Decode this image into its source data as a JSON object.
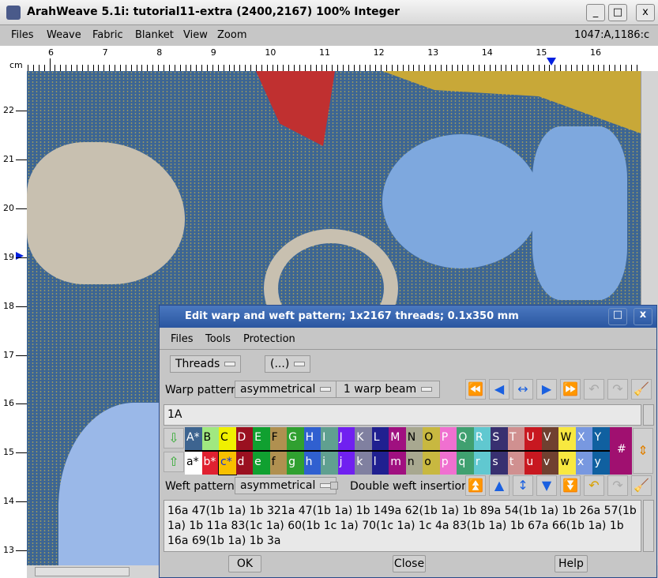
{
  "window": {
    "title": "ArahWeave 5.1i: tutorial11-extra (2400,2167) 100% Integer",
    "min": "_",
    "max": "□",
    "close": "x"
  },
  "menu": [
    "Files",
    "Weave",
    "Fabric",
    "Blanket",
    "View",
    "Zoom"
  ],
  "coords": "1047:A,1186:c",
  "ruler": {
    "unit": "cm",
    "top": [
      "6",
      "7",
      "8",
      "9",
      "10",
      "11",
      "12",
      "13",
      "14",
      "15",
      "16"
    ],
    "left": [
      "22",
      "21",
      "20",
      "19",
      "18",
      "17",
      "16",
      "15",
      "14",
      "13"
    ]
  },
  "dialog": {
    "title": "Edit warp and weft pattern; 1x2167 threads; 0.1x350 mm",
    "menu": [
      "Files",
      "Tools",
      "Protection"
    ],
    "threads": "Threads",
    "paren": "(...)",
    "warp_label": "Warp pattern",
    "warp_sym": "asymmetrical",
    "warp_beam": "1 warp beam",
    "warp_text": "1A",
    "weft_label": "Weft pattern",
    "weft_sym": "asymmetrical",
    "double_weft": "Double weft insertion",
    "double_weft_checked": false,
    "weft_text": "16a 47(1b 1a) 1b 321a 47(1b 1a) 1b 149a 62(1b 1a) 1b 89a 54(1b 1a) 1b 26a 57(1b 1a) 1b 11a 83(1c 1a) 60(1b 1c 1a) 70(1c 1a) 1c 4a 83(1b 1a) 1b 67a 66(1b 1a) 1b 16a 69(1b 1a) 1b 3a",
    "ok": "OK",
    "close": "Close",
    "help": "Help",
    "hash": "#",
    "warp_colors": [
      [
        "A*",
        "#3d6490"
      ],
      [
        "B",
        "#a0e880"
      ],
      [
        "C",
        "#f0f000"
      ],
      [
        "D",
        "#9a1020"
      ],
      [
        "E",
        "#10a030"
      ],
      [
        "F",
        "#b09050"
      ],
      [
        "G",
        "#30a030"
      ],
      [
        "H",
        "#3060d0"
      ],
      [
        "I",
        "#60a090"
      ],
      [
        "J",
        "#7020f0"
      ],
      [
        "K",
        "#8080a0"
      ],
      [
        "L",
        "#202090"
      ],
      [
        "M",
        "#a01080"
      ],
      [
        "N",
        "#a8a890"
      ],
      [
        "O",
        "#c8b840"
      ],
      [
        "P",
        "#f070d0"
      ],
      [
        "Q",
        "#40a070"
      ],
      [
        "R",
        "#60c8d0"
      ],
      [
        "S",
        "#383070"
      ],
      [
        "T",
        "#d09090"
      ],
      [
        "U",
        "#c81820"
      ],
      [
        "V",
        "#704030"
      ],
      [
        "W",
        "#f8e840"
      ],
      [
        "X",
        "#7898e0"
      ],
      [
        "Y",
        "#1060a0"
      ]
    ],
    "weft_colors": [
      [
        "a*",
        "#ffffff"
      ],
      [
        "b*",
        "#e02030"
      ],
      [
        "c*",
        "#f8c000"
      ],
      [
        "d",
        "#9a1020"
      ],
      [
        "e",
        "#10a030"
      ],
      [
        "f",
        "#b09050"
      ],
      [
        "g",
        "#30a030"
      ],
      [
        "h",
        "#3060d0"
      ],
      [
        "i",
        "#60a090"
      ],
      [
        "j",
        "#7020f0"
      ],
      [
        "k",
        "#8080a0"
      ],
      [
        "l",
        "#202090"
      ],
      [
        "m",
        "#a01080"
      ],
      [
        "n",
        "#a8a890"
      ],
      [
        "o",
        "#c8b840"
      ],
      [
        "p",
        "#f070d0"
      ],
      [
        "q",
        "#40a070"
      ],
      [
        "r",
        "#60c8d0"
      ],
      [
        "s",
        "#383070"
      ],
      [
        "t",
        "#d09090"
      ],
      [
        "u",
        "#c81820"
      ],
      [
        "v",
        "#704030"
      ],
      [
        "w",
        "#f8e840"
      ],
      [
        "x",
        "#7898e0"
      ],
      [
        "y",
        "#1060a0"
      ]
    ]
  }
}
